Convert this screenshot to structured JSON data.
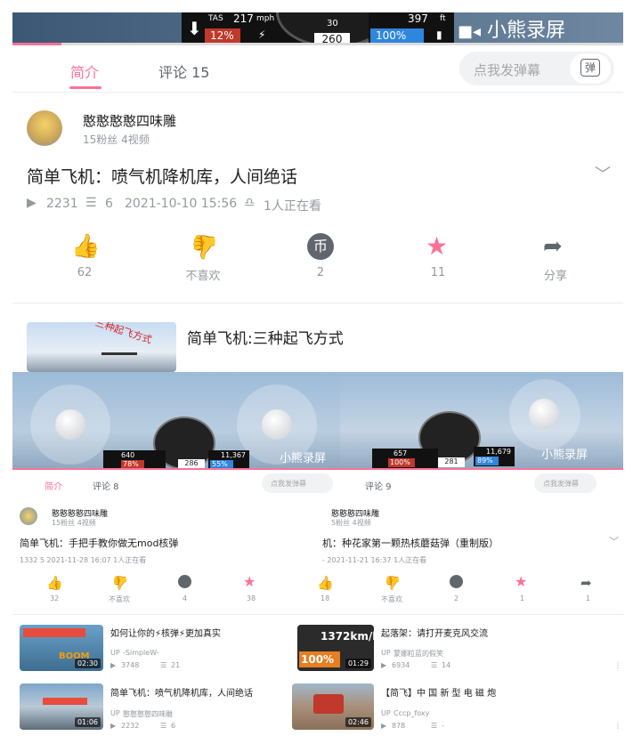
{
  "player": {
    "hud": {
      "tas_label": "TAS",
      "speed": "217",
      "speed_unit": "mph",
      "throttle": "12%",
      "heading_top": "30",
      "heading": "260",
      "altitude": "397",
      "alt_unit": "ft",
      "fuel": "100%"
    },
    "watermark": "小熊录屏",
    "progress": 0.08
  },
  "tabs": [
    {
      "label": "简介"
    },
    {
      "label": "评论 15"
    }
  ],
  "danmu_placeholder": "点我发弹幕",
  "danmu_button": "弹",
  "uploader": {
    "name": "憨憨憨憨四味雕",
    "meta": "15粉丝   4视频"
  },
  "video": {
    "title": "简单飞机：喷气机降机库，人间绝话",
    "views": "2231",
    "comments": "6",
    "date": "2021-10-10 15:56",
    "watching": "1人正在看"
  },
  "actions": [
    {
      "label": "62"
    },
    {
      "label": "不喜欢"
    },
    {
      "label": "2"
    },
    {
      "label": "11"
    },
    {
      "label": "分享"
    }
  ],
  "related_top": {
    "title": "简单飞机:三种起飞方式",
    "thumb_text": "三种起飞方式"
  },
  "colors": {
    "accent": "#fb7299",
    "dark_icon": "#61666d",
    "gray": "#9499a0"
  },
  "left_panel": {
    "hud": {
      "speed": "640",
      "throttle": "78%",
      "heading": "286",
      "altitude": "11,367",
      "fuel": "55%",
      "watermark": "小熊录屏"
    },
    "tabs": [
      "简介",
      "评论 8"
    ],
    "danmu": "点我发弹幕",
    "uploader": "憨憨憨憨四味雕",
    "uploader_meta": "15粉丝   4视频",
    "title": "简单飞机：手把手教你做无mod核弹",
    "stats": "1332   5   2021-11-28 16:07   1人正在看",
    "actions": [
      "32",
      "不喜欢",
      "4",
      "38"
    ]
  },
  "right_panel": {
    "hud": {
      "speed": "657",
      "throttle": "100%",
      "heading": "281",
      "altitude": "11,679",
      "fuel": "89%",
      "watermark": "小熊录屏"
    },
    "tabs": [
      "评论 9"
    ],
    "danmu": "点我发弹幕",
    "uploader": "憨憨憨四味雕",
    "uploader_meta": "5粉丝   4视频",
    "title": "机：种花家第一颗热核蘑菇弹（重制版）",
    "stats": "-   2021-11-21 16:37   1人正在看",
    "actions": [
      "18",
      "不喜欢",
      "2",
      "1",
      "1"
    ]
  },
  "grid": [
    {
      "title": "如何让你的⚡核弹⚡更加真实",
      "author": "-SimpleW-",
      "views": "3748",
      "comments": "21",
      "duration": "02:30",
      "thumb_text": "BOOM"
    },
    {
      "title": "起落架：请打开麦克风交流",
      "author": "蒙娜粒蓝的假笑",
      "views": "6934",
      "comments": "14",
      "duration": "01:29",
      "thumb_text": "1372km/h",
      "thumb_text2": "100%"
    },
    {
      "title": "简单飞机：喷气机降机库，人间绝话",
      "author": "憨憨憨憨四味雕",
      "views": "2232",
      "comments": "6",
      "duration": "01:06"
    },
    {
      "title": "【简飞】中 国 新 型 电 磁 炮",
      "author": "Cccp_foxy",
      "views": "878",
      "comments": "-",
      "duration": "02:46"
    }
  ]
}
